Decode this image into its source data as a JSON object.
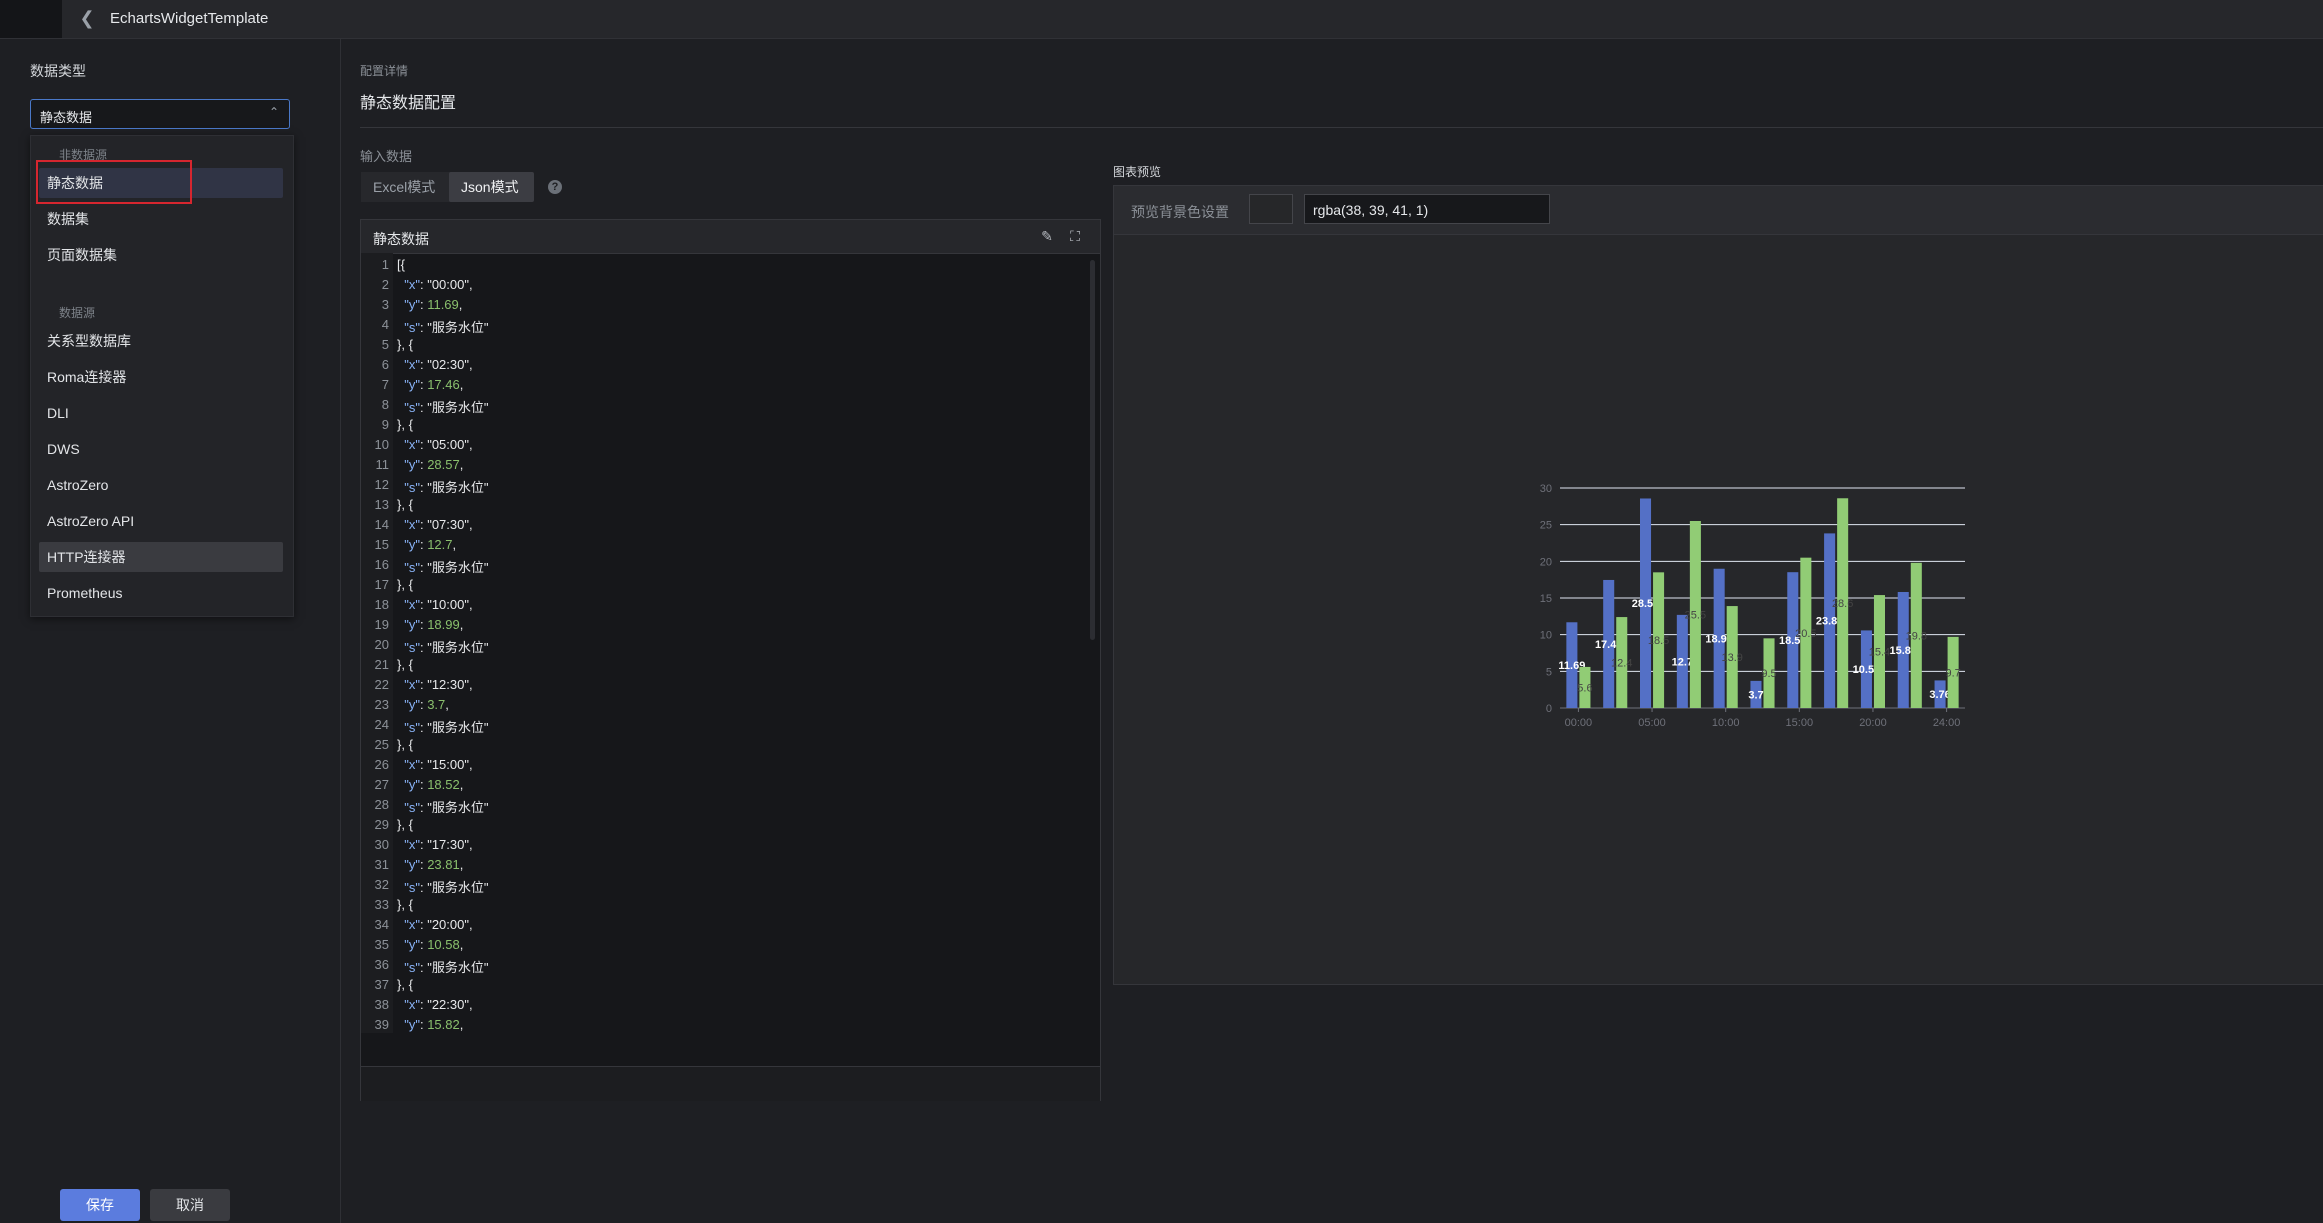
{
  "topbar": {
    "title": "EchartsWidgetTemplate",
    "back_icon": "chevron-left-icon"
  },
  "left": {
    "data_type_label": "数据类型",
    "select_value": "静态数据",
    "dropdown": {
      "group1": "非数据源",
      "items1": [
        "静态数据",
        "数据集",
        "页面数据集"
      ],
      "group2": "数据源",
      "items2": [
        "关系型数据库",
        "Roma连接器",
        "DLI",
        "DWS",
        "AstroZero",
        "AstroZero API",
        "HTTP连接器",
        "Prometheus"
      ]
    },
    "save_label": "保存",
    "cancel_label": "取消"
  },
  "main": {
    "config_sub": "配置详情",
    "config_title": "静态数据配置",
    "input_label": "输入数据",
    "mode_excel": "Excel模式",
    "mode_json": "Json模式",
    "help_glyph": "?",
    "editor_title": "静态数据",
    "clear_icon": "eraser-icon",
    "fullscreen_icon": "fullscreen-icon"
  },
  "code_lines": [
    "[{",
    "  \"x\": \"00:00\",",
    "  \"y\": 11.69,",
    "  \"s\": \"服务水位\"",
    "}, {",
    "  \"x\": \"02:30\",",
    "  \"y\": 17.46,",
    "  \"s\": \"服务水位\"",
    "}, {",
    "  \"x\": \"05:00\",",
    "  \"y\": 28.57,",
    "  \"s\": \"服务水位\"",
    "}, {",
    "  \"x\": \"07:30\",",
    "  \"y\": 12.7,",
    "  \"s\": \"服务水位\"",
    "}, {",
    "  \"x\": \"10:00\",",
    "  \"y\": 18.99,",
    "  \"s\": \"服务水位\"",
    "}, {",
    "  \"x\": \"12:30\",",
    "  \"y\": 3.7,",
    "  \"s\": \"服务水位\"",
    "}, {",
    "  \"x\": \"15:00\",",
    "  \"y\": 18.52,",
    "  \"s\": \"服务水位\"",
    "}, {",
    "  \"x\": \"17:30\",",
    "  \"y\": 23.81,",
    "  \"s\": \"服务水位\"",
    "}, {",
    "  \"x\": \"20:00\",",
    "  \"y\": 10.58,",
    "  \"s\": \"服务水位\"",
    "}, {",
    "  \"x\": \"22:30\",",
    "  \"y\": 15.82,",
    "  \"s\": \"服务水位\"",
    "}, {"
  ],
  "preview": {
    "title": "图表预览",
    "bg_label": "预览背景色设置",
    "bg_value": "rgba(38, 39, 41, 1)"
  },
  "chart_data": {
    "type": "bar",
    "categories": [
      "00:00",
      "02:30",
      "05:00",
      "07:30",
      "10:00",
      "12:30",
      "15:00",
      "17:30",
      "20:00",
      "22:30",
      "24:00"
    ],
    "x_tick_labels": [
      "00:00",
      "05:00",
      "10:00",
      "15:00",
      "20:00",
      "24:00"
    ],
    "series": [
      {
        "values": [
          11.69,
          17.46,
          28.57,
          12.7,
          18.99,
          3.7,
          18.52,
          23.81,
          10.58,
          15.82,
          3.76
        ],
        "color": "#5470c6",
        "labels": [
          "11.69",
          "17.46",
          "28.57",
          "12.7",
          "18.99",
          "3.7",
          "18.52",
          "23.81",
          "10.58",
          "15.82",
          "3.76"
        ]
      },
      {
        "values": [
          5.6,
          12.4,
          18.5,
          25.5,
          13.9,
          9.5,
          20.5,
          28.6,
          15.4,
          19.8,
          9.7
        ],
        "color": "#91cc75",
        "labels": [
          "5.6",
          "12.4",
          "18.5",
          "25.5",
          "13.9",
          "9.5",
          "20.5",
          "28.6",
          "15.4",
          "19.8",
          "9.7"
        ]
      }
    ],
    "ylim": [
      0,
      30
    ],
    "y_ticks": [
      0,
      5,
      10,
      15,
      20,
      25,
      30
    ],
    "grid": true
  }
}
